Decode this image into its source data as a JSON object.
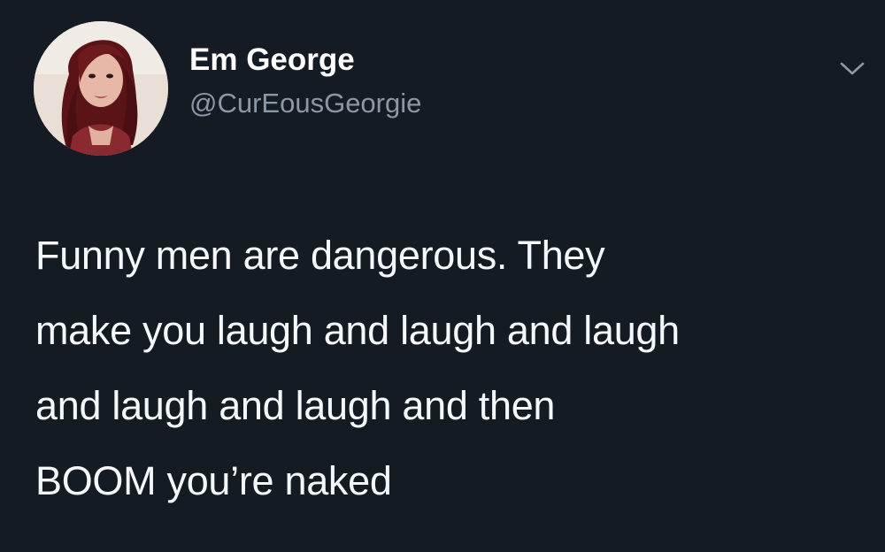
{
  "tweet": {
    "author": {
      "display_name": "Em George",
      "handle": "@CurEousGeorgie",
      "avatar_icon": "profile-photo"
    },
    "menu_icon": "chevron-down-icon",
    "text_lines": [
      "Funny men are dangerous. They",
      "make you laugh and laugh and laugh",
      "and laugh and laugh and then",
      "BOOM you’re naked"
    ]
  },
  "colors": {
    "background": "#141b22",
    "primary_text": "#ffffff",
    "secondary_text": "#8b98a5"
  }
}
